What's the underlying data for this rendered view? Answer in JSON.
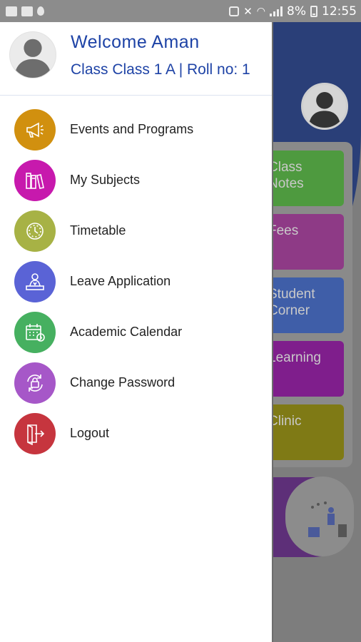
{
  "status_bar": {
    "battery": "8%",
    "time": "12:55"
  },
  "drawer": {
    "welcome_text": "Welcome Aman",
    "class_text": "Class Class 1 A | Roll no: 1",
    "avatar_icon": "person-avatar-icon",
    "items": [
      {
        "label": "Events and Programs",
        "icon": "megaphone-icon",
        "color": "#d1900f"
      },
      {
        "label": "My Subjects",
        "icon": "books-icon",
        "color": "#c719ad"
      },
      {
        "label": "Timetable",
        "icon": "clock-icon",
        "color": "#a7b245"
      },
      {
        "label": "Leave Application",
        "icon": "person-desk-icon",
        "color": "#5a63d6"
      },
      {
        "label": "Academic Calendar",
        "icon": "calendar-icon",
        "color": "#46b060"
      },
      {
        "label": "Change Password",
        "icon": "lock-refresh-icon",
        "color": "#a657c8"
      },
      {
        "label": "Logout",
        "icon": "logout-door-icon",
        "color": "#c6353e"
      }
    ]
  },
  "background_app": {
    "cards": [
      {
        "label": "Class\nNotes",
        "color": "#4e9a3f"
      },
      {
        "label": "Fees",
        "color": "#8e3a86"
      },
      {
        "label": "Student\nCorner",
        "color": "#3f5ea8"
      },
      {
        "label": "Learning",
        "color": "#7f1e8c"
      },
      {
        "label": "Clinic",
        "color": "#7f7a15"
      }
    ]
  }
}
